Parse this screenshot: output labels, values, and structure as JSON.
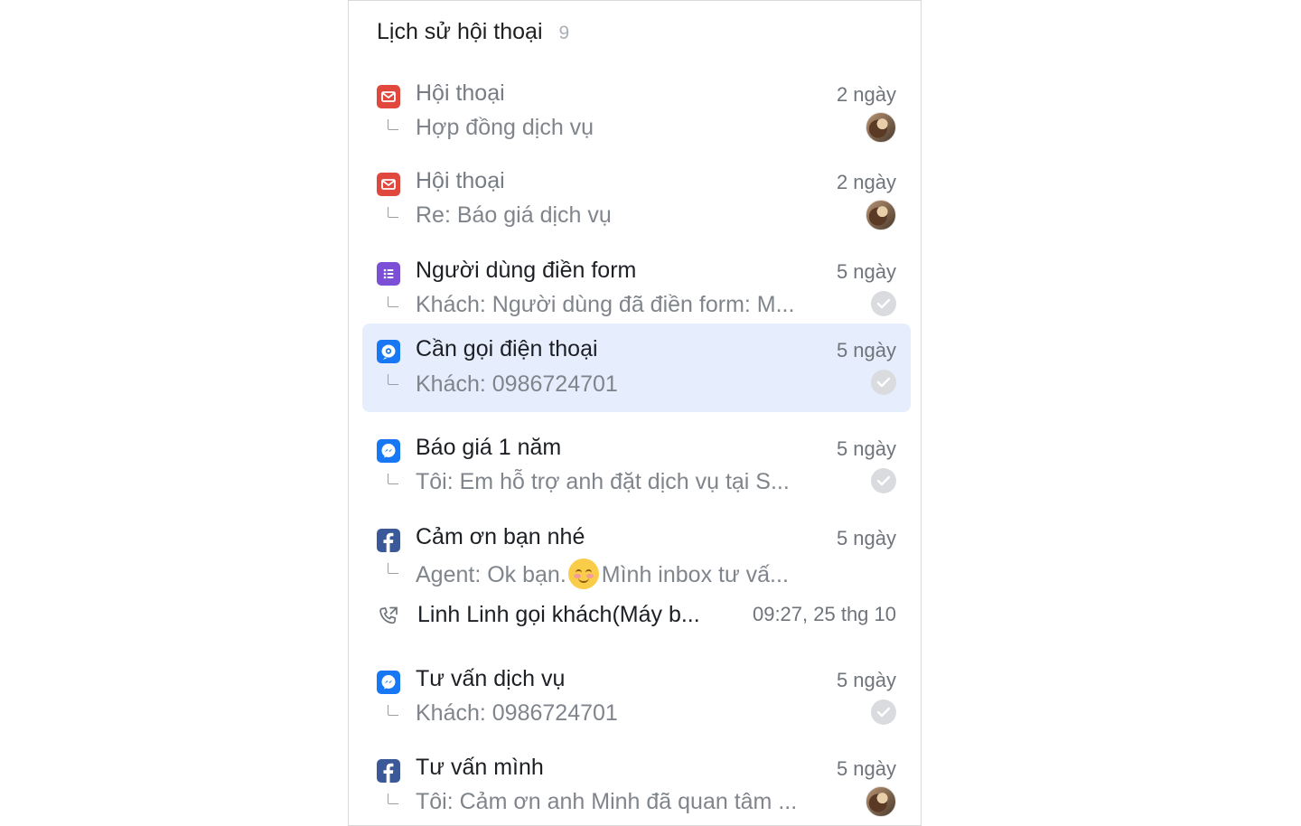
{
  "header": {
    "title": "Lịch sử hội thoại",
    "count": "9"
  },
  "conversations": [
    {
      "channel": "email-icon",
      "title": "Hội thoại",
      "subtitle": "Hợp đồng dịch vụ",
      "time": "2 ngày",
      "status": "avatar",
      "read": true,
      "selected": false
    },
    {
      "channel": "email-icon",
      "title": "Hội thoại",
      "subtitle": "Re: Báo giá dịch vụ",
      "time": "2 ngày",
      "status": "avatar",
      "read": true,
      "selected": false
    },
    {
      "channel": "form-icon",
      "title": "Người dùng điền form",
      "subtitle": "Khách: Người dùng đã điền form: M...",
      "time": "5 ngày",
      "status": "check",
      "read": false,
      "selected": false
    },
    {
      "channel": "call-request-icon",
      "title": "Cần gọi điện thoại",
      "subtitle": "Khách: 0986724701",
      "time": "5 ngày",
      "status": "check",
      "read": false,
      "selected": true
    },
    {
      "channel": "messenger-icon",
      "title": "Báo giá 1 năm",
      "subtitle": "Tôi: Em hỗ trợ anh đặt dịch vụ tại S...",
      "time": "5 ngày",
      "status": "check",
      "read": false,
      "selected": false
    },
    {
      "channel": "facebook-icon",
      "title": "Cảm ơn bạn nhé",
      "subtitle_before": "Agent: Ok bạn.",
      "subtitle_after": "Mình inbox tư vấ...",
      "time": "5 ngày",
      "status": "none",
      "read": false,
      "selected": false
    },
    {
      "channel": "messenger-icon",
      "title": "Tư vấn dịch vụ",
      "subtitle": "Khách: 0986724701",
      "time": "5 ngày",
      "status": "check",
      "read": false,
      "selected": false
    },
    {
      "channel": "facebook-icon",
      "title": "Tư vấn mình",
      "subtitle": "Tôi: Cảm ơn anh Minh đã quan tâm ...",
      "time": "5 ngày",
      "status": "avatar",
      "read": false,
      "selected": false
    }
  ],
  "call_log": {
    "icon": "phone-outgoing-icon",
    "label": "Linh Linh gọi khách(Máy b...",
    "time": "09:27, 25 thg 10"
  },
  "colors": {
    "email": "#e0483e",
    "form": "#7b4fd6",
    "call_request": "#1877f2",
    "messenger": "#1877f2",
    "facebook": "#3b5998",
    "selected_bg": "#e6eefd"
  }
}
